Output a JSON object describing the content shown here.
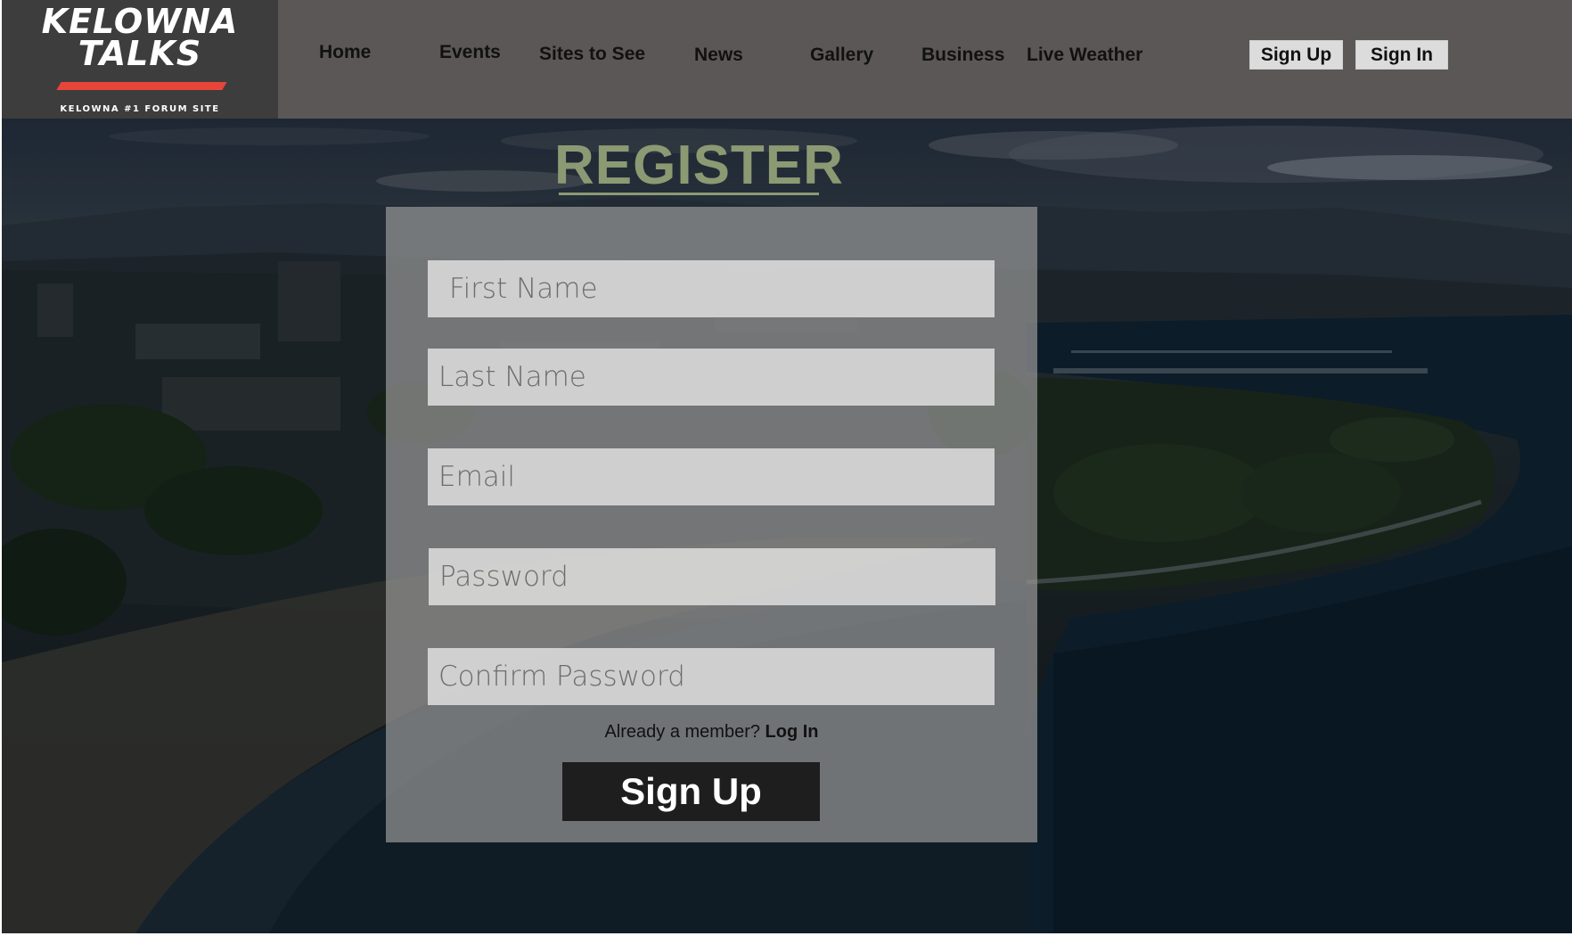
{
  "logo": {
    "line1": "KELOWNA",
    "line2": "TALKS",
    "tagline": "KELOWNA #1 FORUM SITE",
    "accent_color": "#e8443a"
  },
  "nav": {
    "items": [
      {
        "label": "Home"
      },
      {
        "label": "Events"
      },
      {
        "label": "Sites to See"
      },
      {
        "label": "News"
      },
      {
        "label": "Gallery"
      },
      {
        "label": "Business"
      },
      {
        "label": "Live Weather"
      }
    ]
  },
  "header_buttons": {
    "signup": "Sign Up",
    "signin": "Sign In"
  },
  "register": {
    "title": "REGISTER",
    "title_color": "#8c9a73",
    "fields": {
      "first_name": {
        "placeholder": "First Name",
        "value": ""
      },
      "last_name": {
        "placeholder": "Last Name",
        "value": ""
      },
      "email": {
        "placeholder": "Email",
        "value": ""
      },
      "password": {
        "placeholder": "Password",
        "value": ""
      },
      "confirm_password": {
        "placeholder": "Confirm Password",
        "value": ""
      }
    },
    "member_prompt": "Already a member?",
    "login_link": "Log In",
    "submit_label": "Sign Up"
  },
  "colors": {
    "header_bg": "#5b5756",
    "logo_bg": "#3d3d3d",
    "button_bg": "#dcdcdc",
    "submit_bg": "#1e1e1e"
  }
}
